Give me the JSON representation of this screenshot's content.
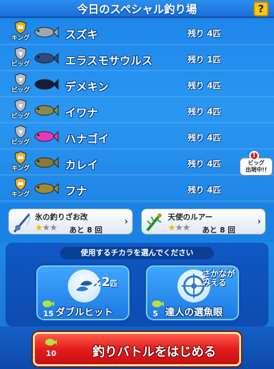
{
  "header": {
    "title": "今日のスペシャル釣り場",
    "help_label": "?"
  },
  "fish": [
    {
      "rank": "キング",
      "rank_type": "king",
      "name": "スズキ",
      "remaining": "残り 4匹",
      "icon": "seabass-icon",
      "color": "#9aa8b2"
    },
    {
      "rank": "ビッグ",
      "rank_type": "big",
      "name": "エラスモサウルス",
      "remaining": "残り 1匹",
      "icon": "elasmosaurus-icon",
      "color": "#2e4a7a"
    },
    {
      "rank": "ビッグ",
      "rank_type": "big",
      "name": "デメキン",
      "remaining": "残り 4匹",
      "icon": "demekin-icon",
      "color": "#1a1a3a"
    },
    {
      "rank": "ビッグ",
      "rank_type": "big",
      "name": "イワナ",
      "remaining": "残り 4匹",
      "icon": "iwana-icon",
      "color": "#8c8a4a"
    },
    {
      "rank": "ビッグ",
      "rank_type": "big",
      "name": "ハナゴイ",
      "remaining": "残り 4匹",
      "icon": "hanagoi-icon",
      "color": "#e838b8"
    },
    {
      "rank": "キング",
      "rank_type": "king",
      "name": "カレイ",
      "remaining": "残り 4匹",
      "icon": "karei-icon",
      "color": "#8a7a3a"
    },
    {
      "rank": "キング",
      "rank_type": "king",
      "name": "フナ",
      "remaining": "残り 4匹",
      "icon": "funa-icon",
      "color": "#a08a3a"
    }
  ],
  "big_alert": {
    "line1": "ビッグ",
    "line2": "出現中!!"
  },
  "items": [
    {
      "name": "氷の釣りざお改",
      "stars_on": 1,
      "stars_total": 3,
      "remaining": "あと 8 回",
      "icon": "fishing-rod-icon"
    },
    {
      "name": "天使のルアー",
      "stars_on": 1,
      "stars_total": 3,
      "remaining": "あと 8 回",
      "icon": "lure-icon"
    }
  ],
  "power": {
    "caption": "使用するチカラを選んでください",
    "double_hit": {
      "label": "ダブルヒット",
      "cost": "15",
      "mark": "×2",
      "unit": "匹"
    },
    "fish_eye": {
      "label": "達人の選魚眼",
      "cost": "5",
      "mark_line1": "さかなが",
      "mark_line2": "みえる"
    }
  },
  "start": {
    "label": "釣りバトルをはじめる",
    "cost": "10"
  },
  "colors": {
    "king_gold": "#e8b020",
    "big_silver": "#b8bcc4",
    "accent_red": "#e21d1d",
    "bg_blue": "#1a7fe0"
  }
}
